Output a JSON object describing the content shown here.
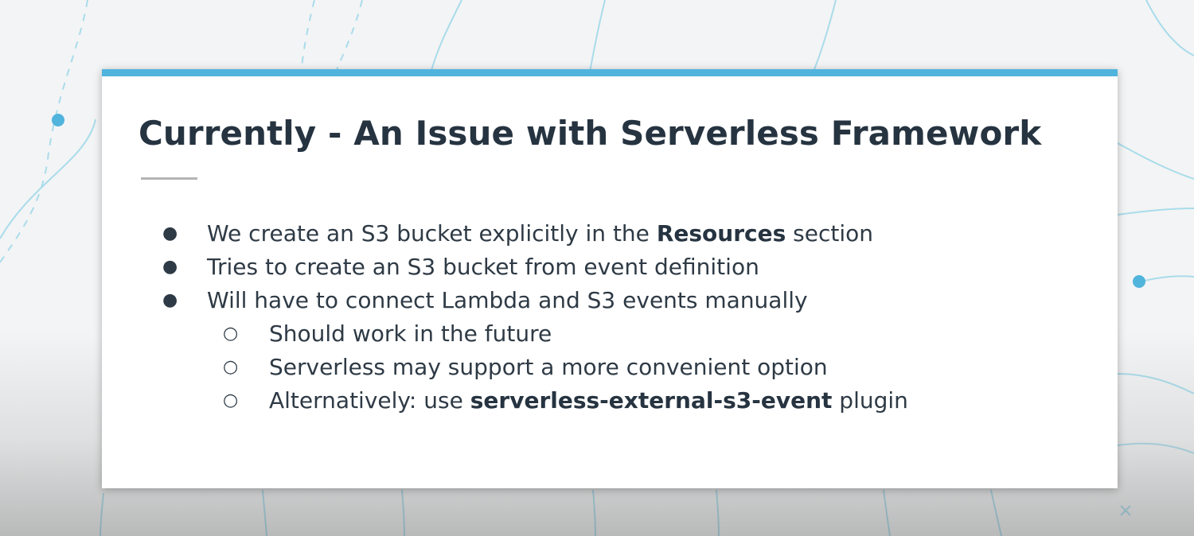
{
  "slide": {
    "title": "Currently - An Issue with Serverless Framework",
    "accent_color": "#50b4dc",
    "bullets": [
      {
        "before": "We create an S3 bucket explicitly in the ",
        "bold": "Resources",
        "after": " section"
      },
      {
        "text": "Tries to create an S3 bucket from event definition"
      },
      {
        "text": "Will have to connect Lambda and S3 events manually",
        "subitems": [
          {
            "text": "Should work in the future"
          },
          {
            "text": "Serverless may support a more convenient option"
          },
          {
            "before": "Alternatively: use ",
            "bold": "serverless-external-s3-event",
            "after": " plugin"
          }
        ]
      }
    ]
  },
  "icons": {
    "bullet_level1": "●",
    "bullet_level2": "○"
  }
}
